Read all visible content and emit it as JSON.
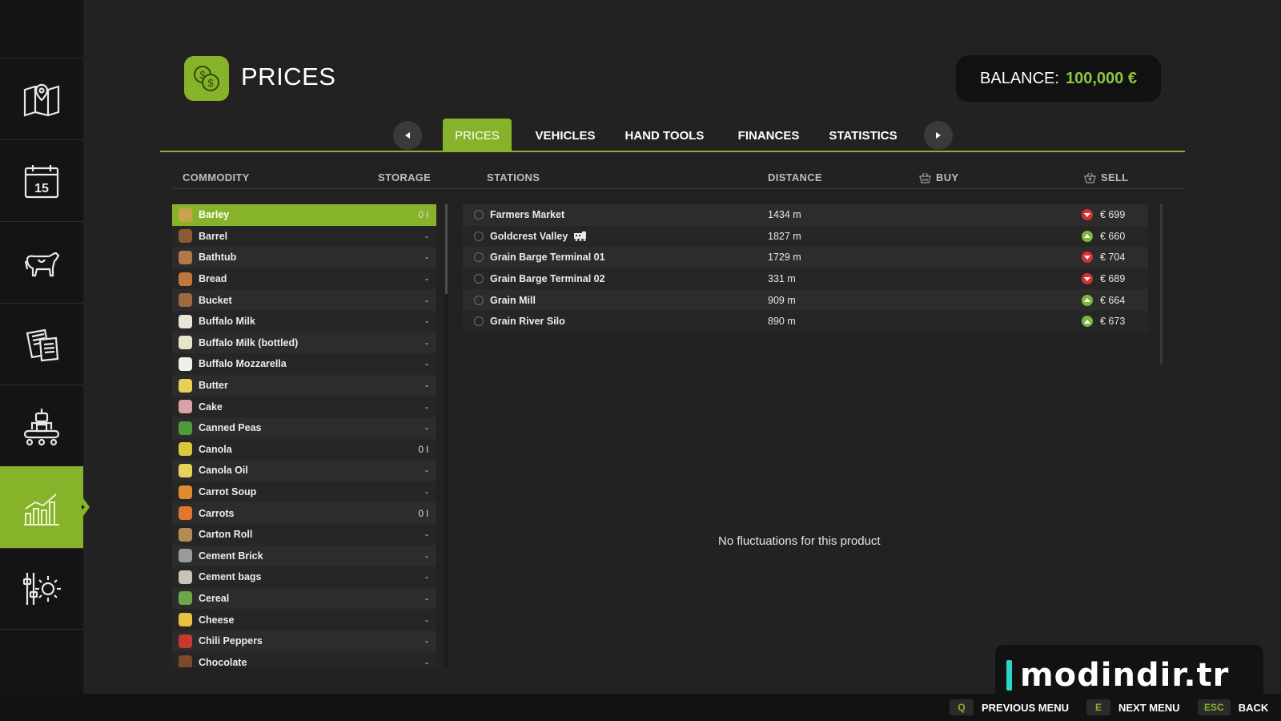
{
  "sidebar": {
    "items": [
      {
        "icon": "map-icon"
      },
      {
        "icon": "calendar-icon",
        "label": "15"
      },
      {
        "icon": "animals-icon"
      },
      {
        "icon": "contracts-icon"
      },
      {
        "icon": "production-icon"
      },
      {
        "icon": "statistics-chart-icon",
        "active": true
      },
      {
        "icon": "settings-icon"
      }
    ]
  },
  "header": {
    "title": "PRICES",
    "icon": "prices-coins-icon",
    "balance_label": "BALANCE:",
    "balance_value": "100,000 €"
  },
  "tabs": {
    "items": [
      "PRICES",
      "VEHICLES",
      "HAND TOOLS",
      "FINANCES",
      "STATISTICS"
    ],
    "active": "PRICES"
  },
  "columns": {
    "commodity": "COMMODITY",
    "storage": "STORAGE",
    "stations": "STATIONS",
    "distance": "DISTANCE",
    "buy": "BUY",
    "sell": "SELL"
  },
  "commodities": [
    {
      "name": "Barley",
      "storage": "0 l",
      "color": "#c9a24a",
      "selected": true
    },
    {
      "name": "Barrel",
      "storage": "-",
      "color": "#8a5a34"
    },
    {
      "name": "Bathtub",
      "storage": "-",
      "color": "#b07a46"
    },
    {
      "name": "Bread",
      "storage": "-",
      "color": "#c2773a"
    },
    {
      "name": "Bucket",
      "storage": "-",
      "color": "#9b6b3f"
    },
    {
      "name": "Buffalo Milk",
      "storage": "-",
      "color": "#e8e4d8"
    },
    {
      "name": "Buffalo Milk (bottled)",
      "storage": "-",
      "color": "#e9e3c8"
    },
    {
      "name": "Buffalo Mozzarella",
      "storage": "-",
      "color": "#f0efe9"
    },
    {
      "name": "Butter",
      "storage": "-",
      "color": "#e9cf55"
    },
    {
      "name": "Cake",
      "storage": "-",
      "color": "#d9a1a8"
    },
    {
      "name": "Canned Peas",
      "storage": "-",
      "color": "#4f9a3d"
    },
    {
      "name": "Canola",
      "storage": "0 l",
      "color": "#d8c93a"
    },
    {
      "name": "Canola Oil",
      "storage": "-",
      "color": "#e7d25a"
    },
    {
      "name": "Carrot Soup",
      "storage": "-",
      "color": "#e08a2e"
    },
    {
      "name": "Carrots",
      "storage": "0 l",
      "color": "#e2762a"
    },
    {
      "name": "Carton Roll",
      "storage": "-",
      "color": "#b48b55"
    },
    {
      "name": "Cement Brick",
      "storage": "-",
      "color": "#9a9a9a"
    },
    {
      "name": "Cement bags",
      "storage": "-",
      "color": "#c8c2b8"
    },
    {
      "name": "Cereal",
      "storage": "-",
      "color": "#6fa64a"
    },
    {
      "name": "Cheese",
      "storage": "-",
      "color": "#e9c23d"
    },
    {
      "name": "Chili Peppers",
      "storage": "-",
      "color": "#c93a2e"
    },
    {
      "name": "Chocolate",
      "storage": "-",
      "color": "#7a4a2a"
    }
  ],
  "stations": [
    {
      "name": "Farmers Market",
      "distance": "1434 m",
      "trend": "down",
      "sell": "€ 699",
      "train": false
    },
    {
      "name": "Goldcrest Valley",
      "distance": "1827 m",
      "trend": "up",
      "sell": "€ 660",
      "train": true
    },
    {
      "name": "Grain Barge Terminal 01",
      "distance": "1729 m",
      "trend": "down",
      "sell": "€ 704",
      "train": false
    },
    {
      "name": "Grain Barge Terminal 02",
      "distance": "331 m",
      "trend": "down",
      "sell": "€ 689",
      "train": false
    },
    {
      "name": "Grain Mill",
      "distance": "909 m",
      "trend": "up",
      "sell": "€ 664",
      "train": false
    },
    {
      "name": "Grain River Silo",
      "distance": "890 m",
      "trend": "up",
      "sell": "€ 673",
      "train": false
    }
  ],
  "no_fluctuations": "No fluctuations for this product",
  "watermark": "modindir.tr",
  "bottom_hints": [
    {
      "key": "Q",
      "label": "PREVIOUS MENU"
    },
    {
      "key": "E",
      "label": "NEXT MENU"
    },
    {
      "key": "ESC",
      "label": "BACK"
    }
  ],
  "colors": {
    "accent": "#87b32a",
    "balance_value": "#8cc63f",
    "trend_down": "#d9302f",
    "trend_up": "#7cb83a"
  }
}
